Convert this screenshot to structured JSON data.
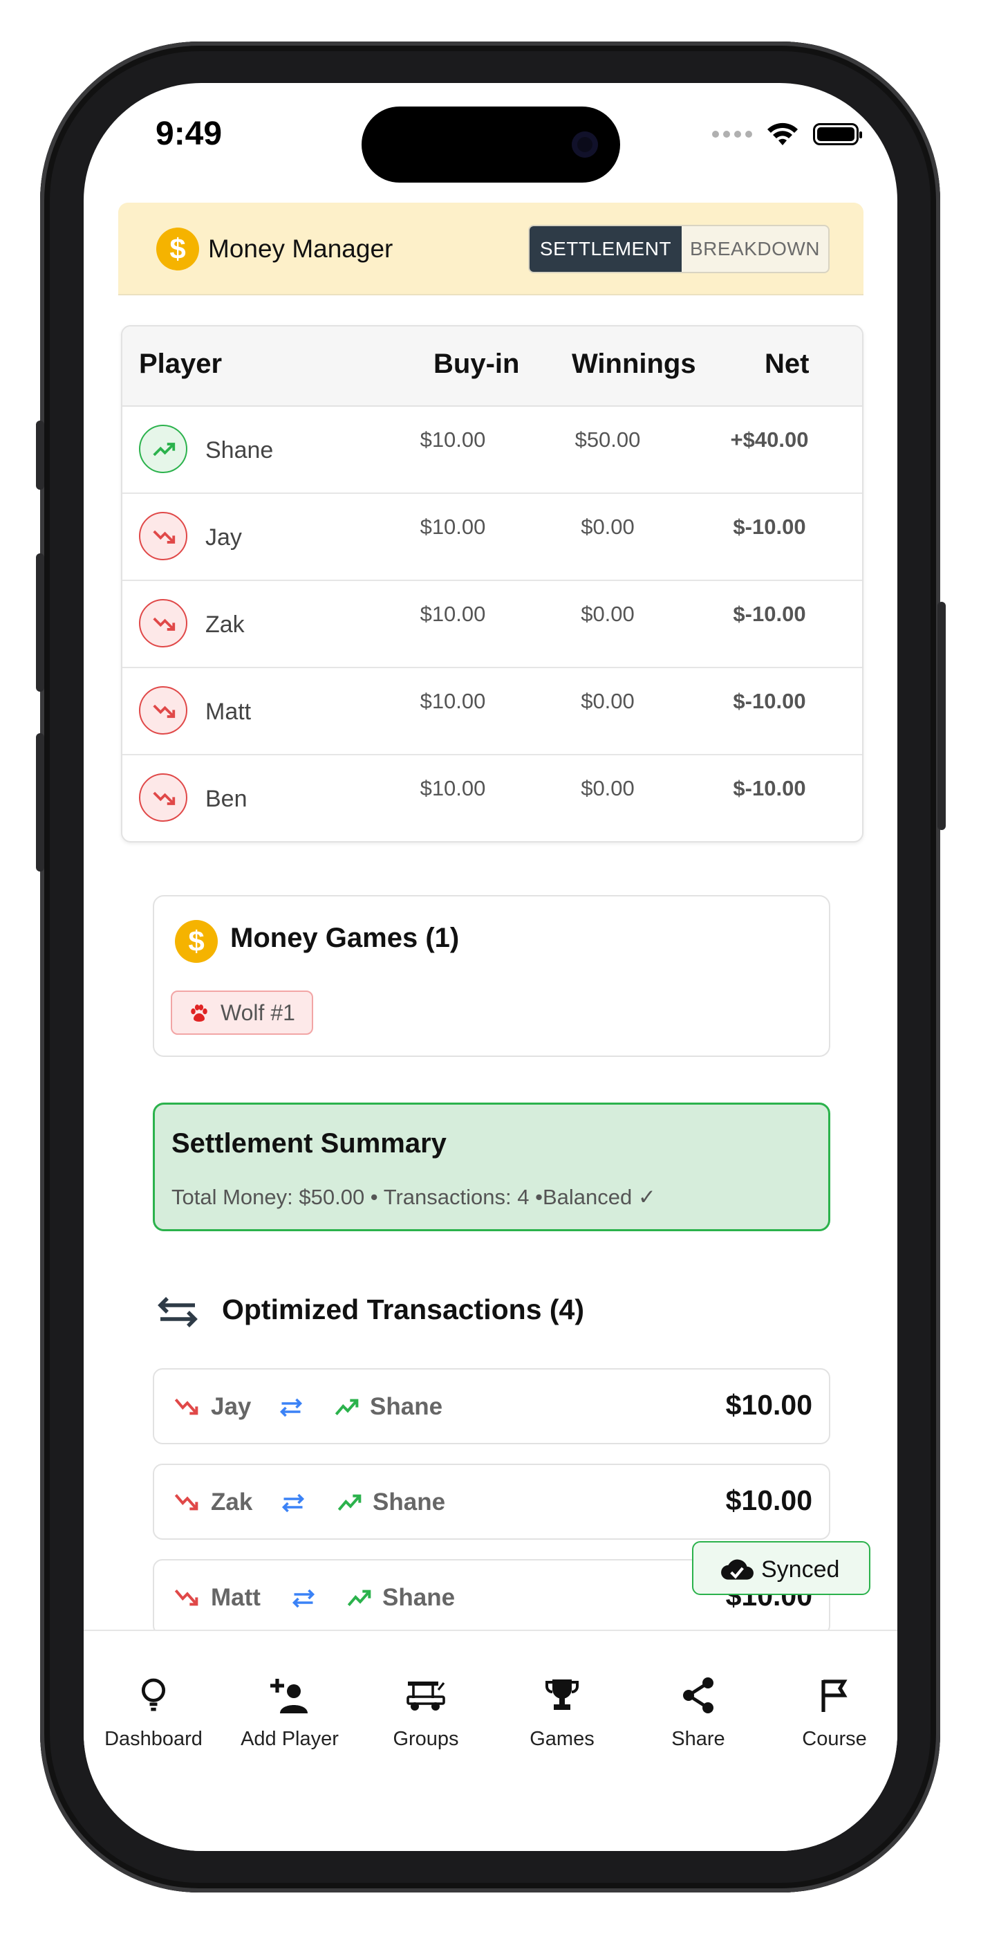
{
  "status": {
    "time": "9:49"
  },
  "header": {
    "title": "Money Manager",
    "coin_symbol": "$",
    "tabs": {
      "settlement": "SETTLEMENT",
      "breakdown": "BREAKDOWN"
    }
  },
  "table": {
    "columns": {
      "player": "Player",
      "buyin": "Buy-in",
      "winnings": "Winnings",
      "net": "Net"
    },
    "rows": [
      {
        "name": "Shane",
        "buyin": "$10.00",
        "winnings": "$50.00",
        "net": "+$40.00",
        "trend": "up"
      },
      {
        "name": "Jay",
        "buyin": "$10.00",
        "winnings": "$0.00",
        "net": "$-10.00",
        "trend": "down"
      },
      {
        "name": "Zak",
        "buyin": "$10.00",
        "winnings": "$0.00",
        "net": "$-10.00",
        "trend": "down"
      },
      {
        "name": "Matt",
        "buyin": "$10.00",
        "winnings": "$0.00",
        "net": "$-10.00",
        "trend": "down"
      },
      {
        "name": "Ben",
        "buyin": "$10.00",
        "winnings": "$0.00",
        "net": "$-10.00",
        "trend": "down"
      }
    ]
  },
  "money_games": {
    "title": "Money Games (1)",
    "coin_symbol": "$",
    "chips": [
      {
        "label": "Wolf #1",
        "icon": "paw-icon"
      }
    ]
  },
  "summary": {
    "title": "Settlement Summary",
    "text": "Total Money: $50.00 • Transactions: 4 •Balanced ✓"
  },
  "transactions": {
    "title": "Optimized Transactions (4)",
    "items": [
      {
        "from": "Jay",
        "to": "Shane",
        "amount": "$10.00"
      },
      {
        "from": "Zak",
        "to": "Shane",
        "amount": "$10.00"
      },
      {
        "from": "Matt",
        "to": "Shane",
        "amount": "$10.00"
      }
    ]
  },
  "sync": {
    "label": "Synced"
  },
  "colors": {
    "accent": "#2e3b47",
    "positive": "#2bb24c",
    "negative": "#e04848",
    "coin": "#f5b300",
    "swap": "#3b82f6"
  },
  "tabbar": {
    "items": [
      {
        "label": "Dashboard",
        "icon": "lightbulb-icon"
      },
      {
        "label": "Add Player",
        "icon": "add-user-icon"
      },
      {
        "label": "Groups",
        "icon": "golf-cart-icon"
      },
      {
        "label": "Games",
        "icon": "trophy-icon"
      },
      {
        "label": "Share",
        "icon": "share-icon"
      },
      {
        "label": "Course",
        "icon": "flag-icon"
      }
    ]
  }
}
